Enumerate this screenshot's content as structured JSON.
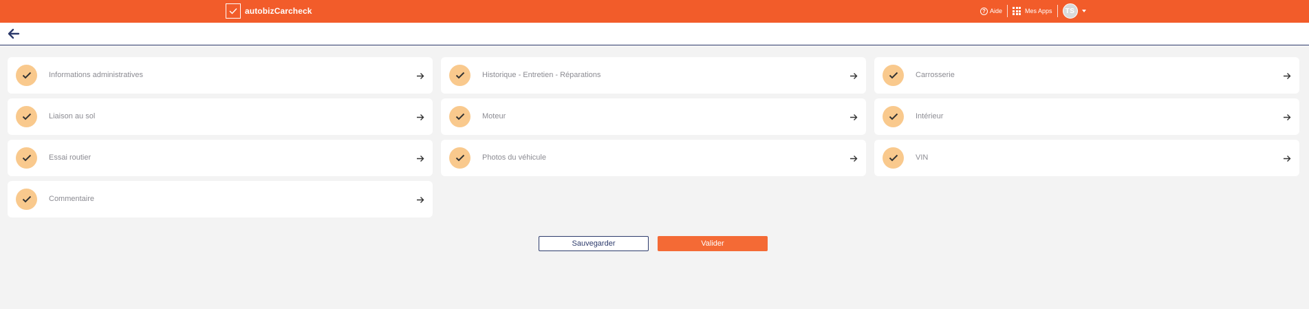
{
  "header": {
    "brand": "autobizCarcheck",
    "help_label": "Aide",
    "apps_label": "Mes Apps",
    "avatar_initials": "TS",
    "bg_color": "#f25c2a"
  },
  "sections": [
    {
      "label": "Informations administratives",
      "completed": true
    },
    {
      "label": "Historique - Entretien - Réparations",
      "completed": true
    },
    {
      "label": "Carrosserie",
      "completed": true
    },
    {
      "label": "Liaison au sol",
      "completed": true
    },
    {
      "label": "Moteur",
      "completed": true
    },
    {
      "label": "Intérieur",
      "completed": true
    },
    {
      "label": "Essai routier",
      "completed": true
    },
    {
      "label": "Photos du véhicule",
      "completed": true
    },
    {
      "label": "VIN",
      "completed": true
    },
    {
      "label": "Commentaire",
      "completed": true
    }
  ],
  "actions": {
    "save_label": "Sauvegarder",
    "validate_label": "Valider"
  },
  "icons": {
    "back": "arrow-left-icon",
    "section_status": "check-icon",
    "section_open": "arrow-right-icon",
    "help": "question-circle-icon",
    "apps": "apps-grid-icon",
    "user_menu": "caret-down-icon"
  },
  "colors": {
    "accent": "#f25c2a",
    "check_bg": "#f9c98d",
    "navy": "#2c3a6b"
  }
}
